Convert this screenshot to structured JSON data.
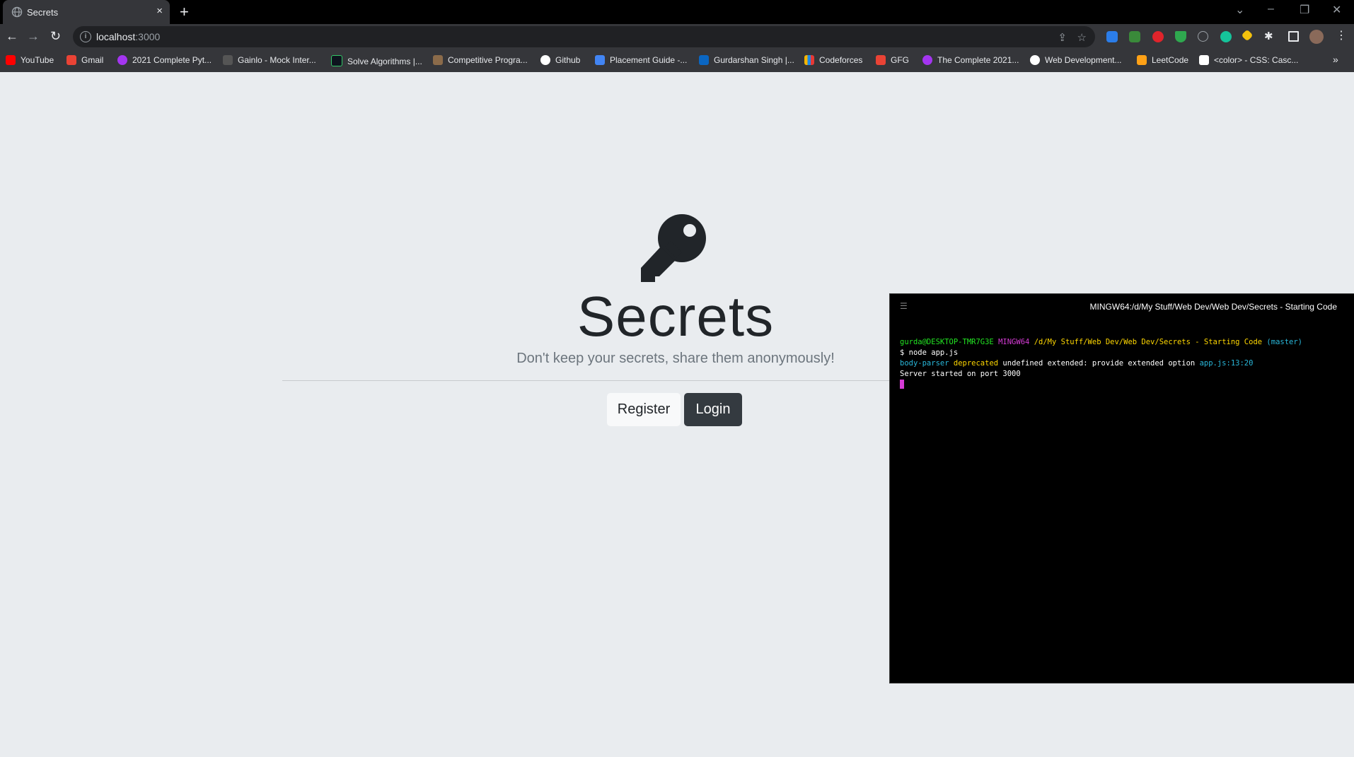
{
  "browser": {
    "tab_title": "Secrets",
    "tab_close": "×",
    "new_tab": "+",
    "url_host": "localhost",
    "url_port": ":3000",
    "bookmarks": [
      {
        "label": "YouTube",
        "color": "#ff0000"
      },
      {
        "label": "Gmail",
        "color": "#ea4335"
      },
      {
        "label": "2021 Complete Pyt...",
        "color": "#a435f0"
      },
      {
        "label": "Gainlo - Mock Inter...",
        "color": "#9aa0a6"
      },
      {
        "label": "Solve Algorithms |...",
        "color": "#32c766"
      },
      {
        "label": "Competitive Progra...",
        "color": "#8b6b4a"
      },
      {
        "label": "Github",
        "color": "#ffffff"
      },
      {
        "label": "Placement Guide -...",
        "color": "#4285f4"
      },
      {
        "label": "Gurdarshan Singh |...",
        "color": "#0a66c2"
      },
      {
        "label": "Codeforces",
        "color": "#f4b400"
      },
      {
        "label": "GFG",
        "color": "#ea4335"
      },
      {
        "label": "The Complete 2021...",
        "color": "#a435f0"
      },
      {
        "label": "Web Development...",
        "color": "#ffffff"
      },
      {
        "label": "LeetCode",
        "color": "#ffa116"
      },
      {
        "label": "<color> - CSS: Casc...",
        "color": "#ffffff"
      }
    ],
    "more_bookmarks": "»"
  },
  "page": {
    "title": "Secrets",
    "lead": "Don't keep your secrets, share them anonymously!",
    "register_label": "Register",
    "login_label": "Login"
  },
  "terminal": {
    "title": "MINGW64:/d/My Stuff/Web Dev/Web Dev/Secrets - Starting Code",
    "user": "gurda@DESKTOP-TMR7G3E",
    "env": "MINGW64",
    "path": "/d/My Stuff/Web Dev/Web Dev/Secrets - Starting Code",
    "branch": "(master)",
    "command": "$ node app.js",
    "warn_module": "body-parser",
    "warn_word": "deprecated",
    "warn_text": "undefined extended: provide extended option",
    "warn_loc": "app.js:13:20",
    "server_msg": "Server started on port 3000"
  },
  "colors": {
    "page_bg": "#e9ecef",
    "login_bg": "#343a40",
    "register_bg": "#f8f9fa",
    "terminal_bg": "#000000"
  }
}
